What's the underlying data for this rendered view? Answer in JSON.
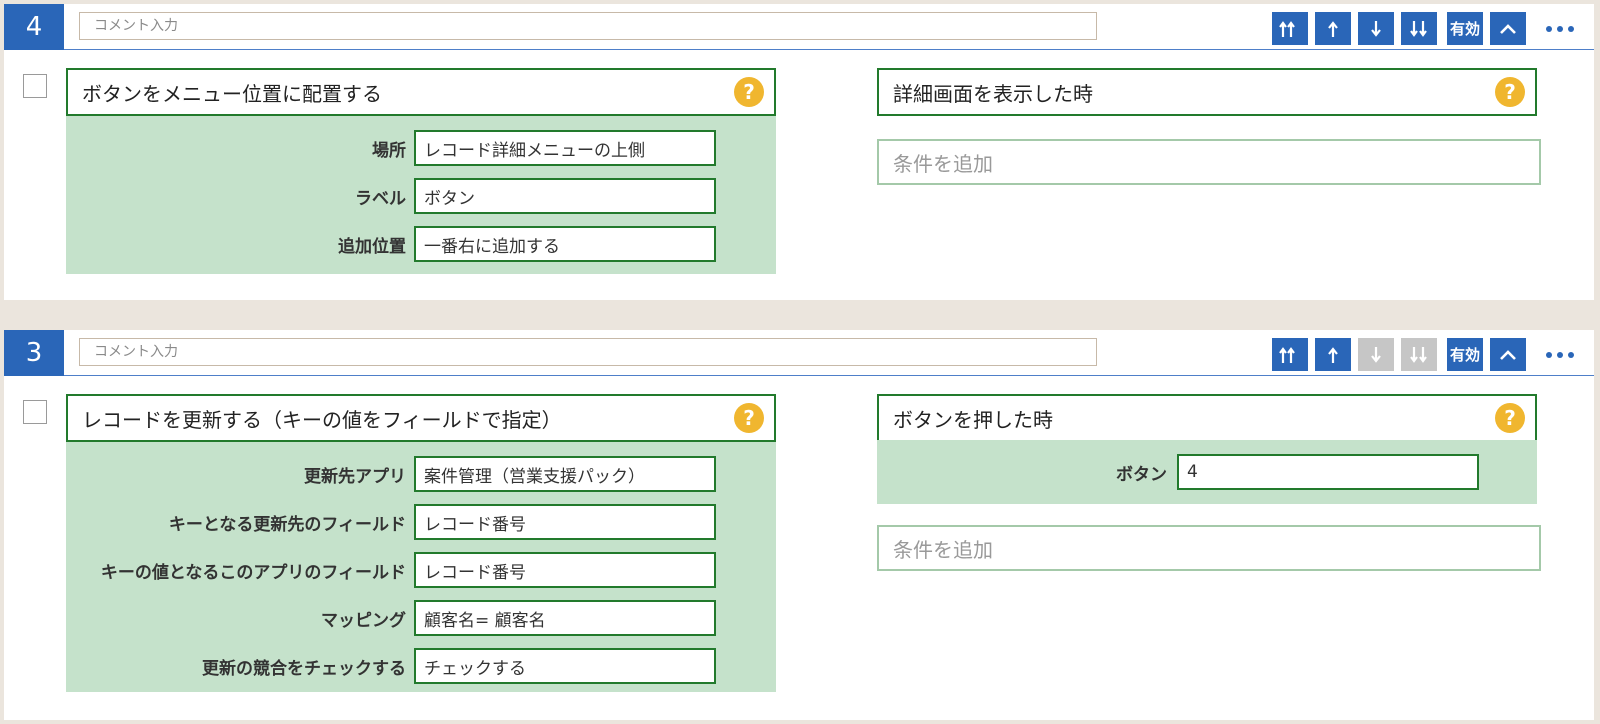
{
  "rules": [
    {
      "number": "4",
      "comment_placeholder": "コメント入力",
      "toolbar": {
        "move_top": "move-top",
        "move_up": "move-up",
        "move_down": "move-down",
        "move_bottom": "move-bottom",
        "enabled_label": "有効",
        "collapse": "collapse",
        "more": "more"
      },
      "action": {
        "title": "ボタンをメニュー位置に配置する",
        "help": "?",
        "params": [
          {
            "label": "場所",
            "value": "レコード詳細メニューの上側"
          },
          {
            "label": "ラベル",
            "value": "ボタン"
          },
          {
            "label": "追加位置",
            "value": "一番右に追加する"
          }
        ]
      },
      "condition": {
        "title": "詳細画面を表示した時",
        "help": "?",
        "add_label": "条件を追加"
      }
    },
    {
      "number": "3",
      "comment_placeholder": "コメント入力",
      "toolbar": {
        "enabled_label": "有効",
        "down_disabled": true
      },
      "action": {
        "title": "レコードを更新する（キーの値をフィールドで指定）",
        "help": "?",
        "params": [
          {
            "label": "更新先アプリ",
            "value": "案件管理（営業支援パック）"
          },
          {
            "label": "キーとなる更新先のフィールド",
            "value": "レコード番号"
          },
          {
            "label": "キーの値となるこのアプリのフィールド",
            "value": "レコード番号"
          },
          {
            "label": "マッピング",
            "value": "顧客名= 顧客名"
          },
          {
            "label": "更新の競合をチェックする",
            "value": "チェックする"
          }
        ]
      },
      "condition": {
        "title": "ボタンを押した時",
        "help": "?",
        "param": {
          "label": "ボタン",
          "value": "4"
        },
        "add_label": "条件を追加"
      }
    }
  ],
  "colors": {
    "accent": "#2a66b8",
    "border_green": "#227a2c",
    "param_bg": "#c5e2cb",
    "help": "#f0b62f",
    "disabled": "#c6c6c6"
  }
}
